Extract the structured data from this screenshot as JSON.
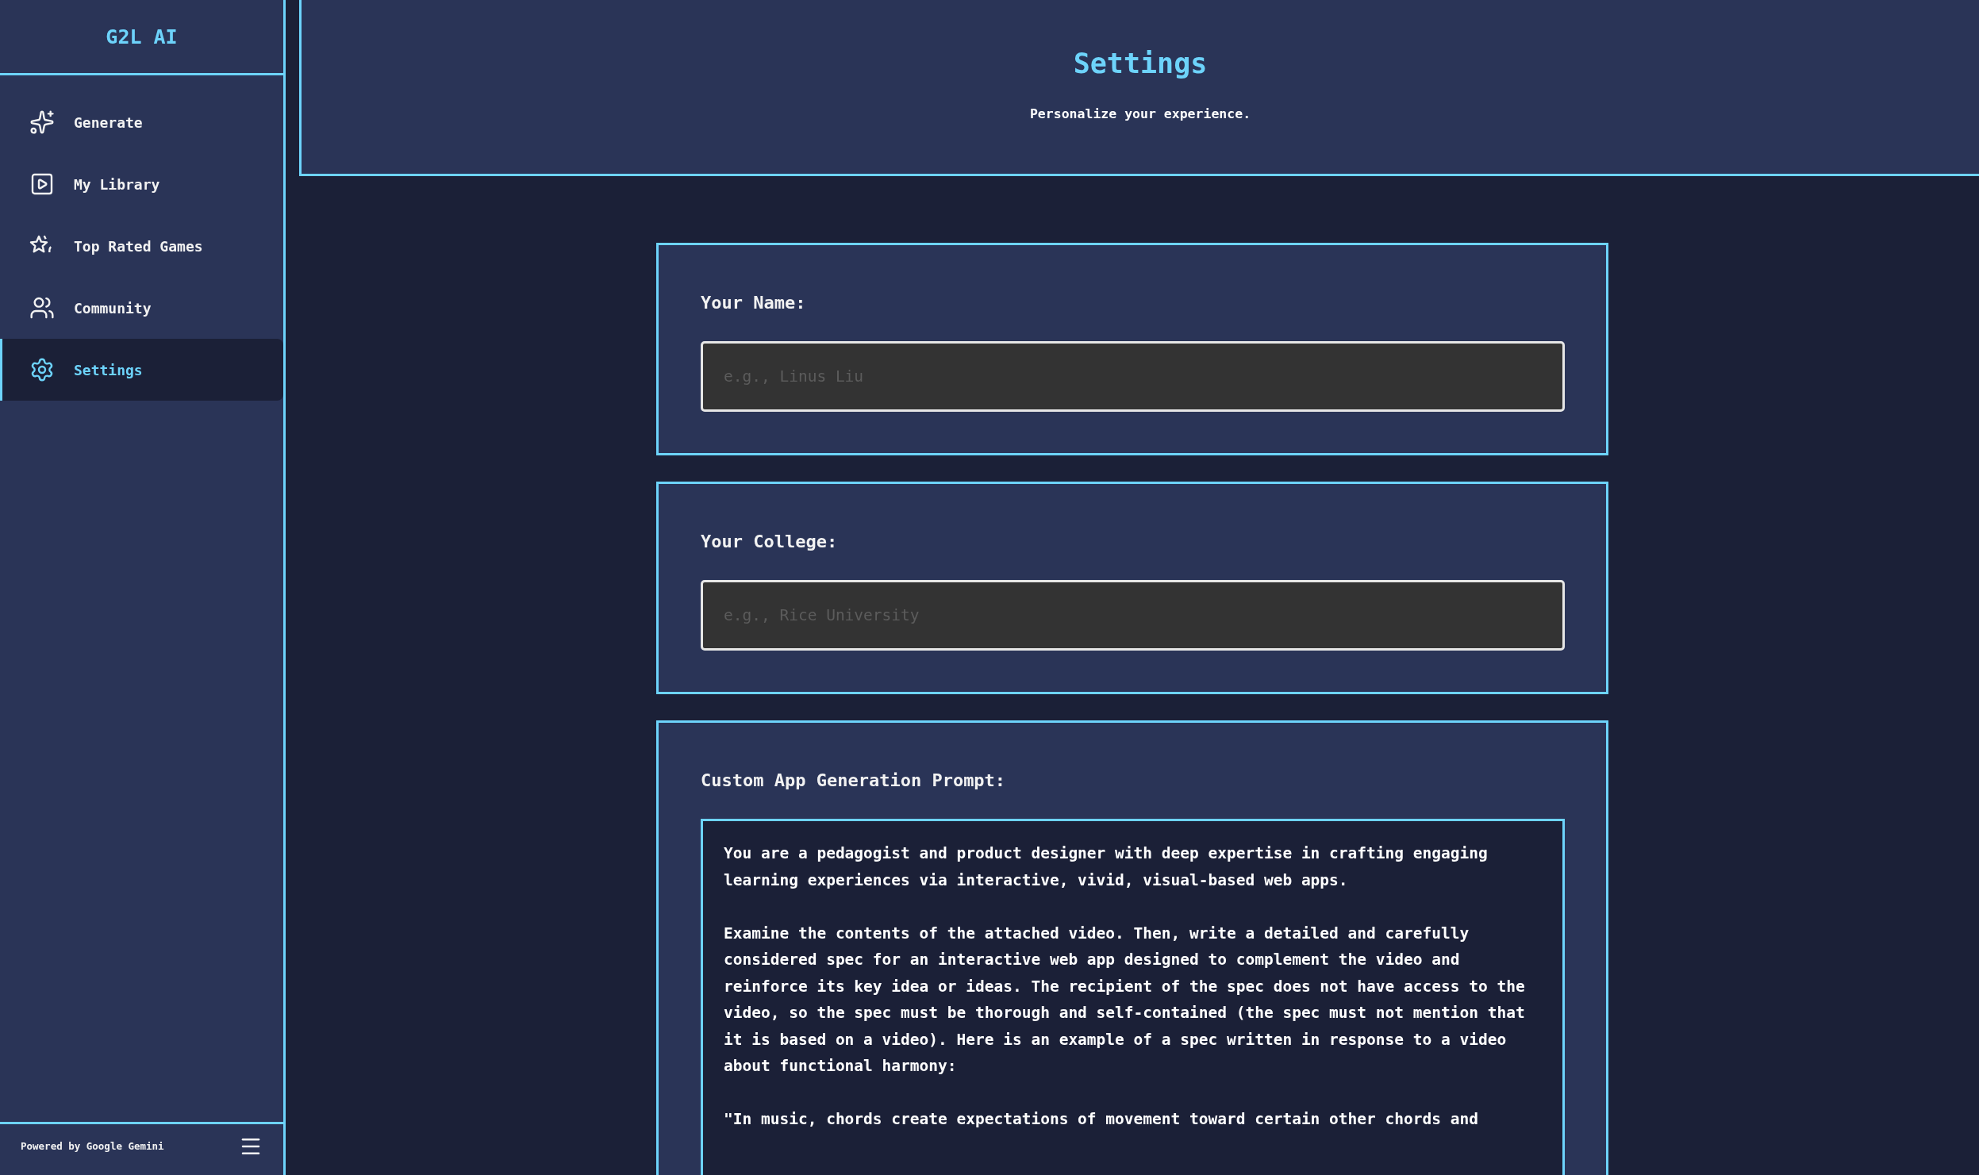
{
  "sidebar": {
    "logo": "G2L AI",
    "items": [
      {
        "kind": "sparkles",
        "label": "Generate",
        "selected": false
      },
      {
        "kind": "library",
        "label": "My Library",
        "selected": false
      },
      {
        "kind": "star",
        "label": "Top Rated Games",
        "selected": false
      },
      {
        "kind": "users",
        "label": "Community",
        "selected": false
      },
      {
        "kind": "settings",
        "label": "Settings",
        "selected": true
      }
    ],
    "footer": "Powered by Google Gemini"
  },
  "header": {
    "title": "Settings",
    "subtitle": "Personalize your experience."
  },
  "fields": [
    {
      "kind": "input",
      "label": "Your Name:",
      "placeholder": "e.g., Linus Liu"
    },
    {
      "kind": "input",
      "label": "Your College:",
      "placeholder": "e.g., Rice University"
    },
    {
      "kind": "textarea",
      "label": "Custom App Generation Prompt:",
      "value": "You are a pedagogist and product designer with deep expertise in crafting engaging learning experiences via interactive, vivid, visual-based web apps.\n\nExamine the contents of the attached video. Then, write a detailed and carefully considered spec for an interactive web app designed to complement the video and reinforce its key idea or ideas. The recipient of the spec does not have access to the video, so the spec must be thorough and self-contained (the spec must not mention that it is based on a video). Here is an example of a spec written in response to a video about functional harmony:\n\n\"In music, chords create expectations of movement toward certain other chords and"
    }
  ]
}
